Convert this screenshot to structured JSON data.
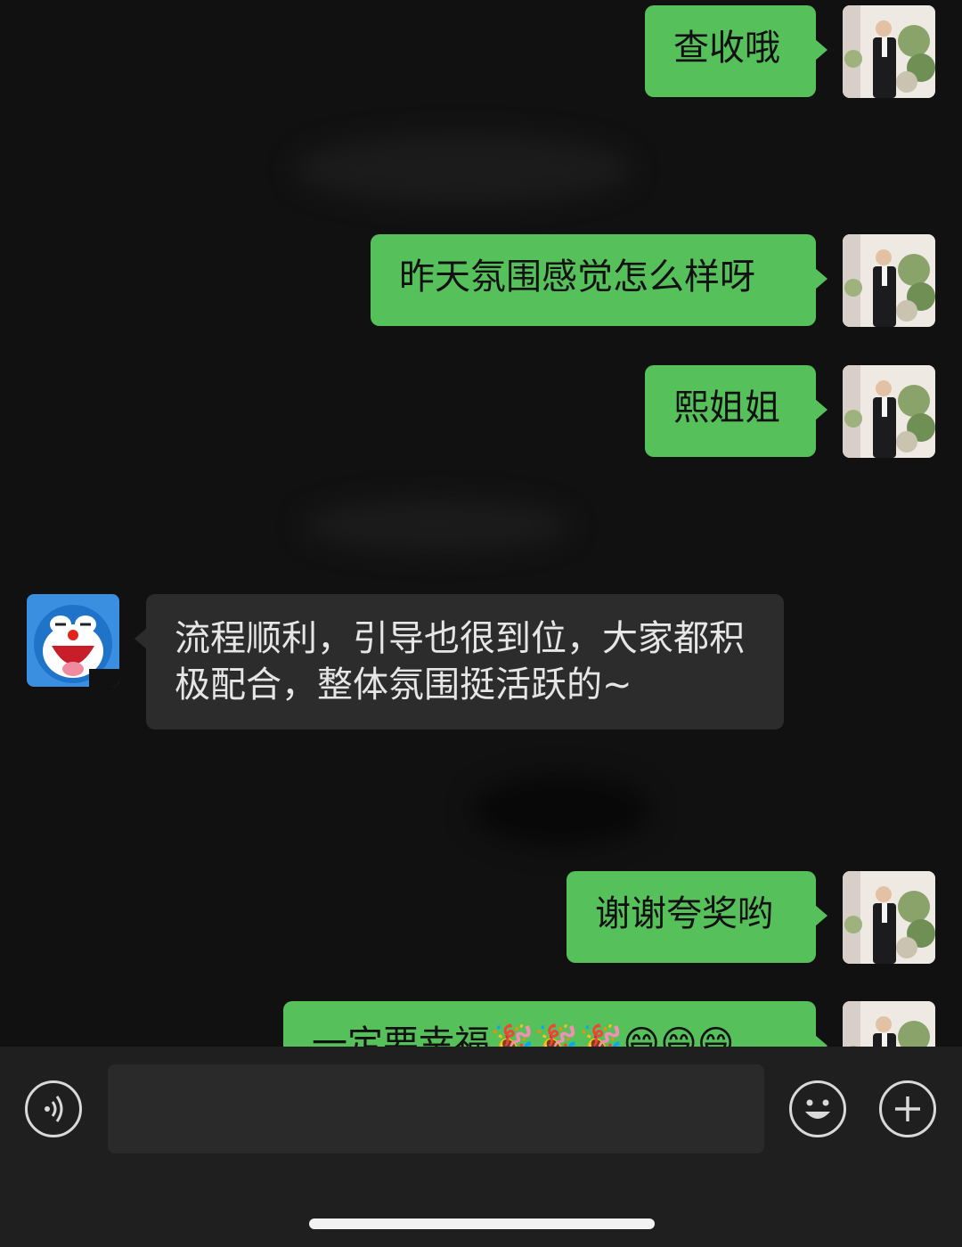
{
  "messages": [
    {
      "direction": "out",
      "text": "查收哦"
    },
    {
      "direction": "out",
      "text": "昨天氛围感觉怎么样呀"
    },
    {
      "direction": "out",
      "text": "熙姐姐"
    },
    {
      "direction": "in",
      "text": "流程顺利，引导也很到位，大家都积极配合，整体氛围挺活跃的~"
    },
    {
      "direction": "out",
      "text": "谢谢夸奖哟"
    },
    {
      "direction": "out",
      "text": "一定要幸福🎉🎉🎉😄😄😄"
    }
  ],
  "input": {
    "value": "",
    "placeholder": ""
  },
  "icons": {
    "voice": "voice-icon",
    "emoji": "emoji-icon",
    "plus": "plus-icon",
    "sender_avatar": "groom-photo-avatar",
    "receiver_avatar": "cartoon-cat-avatar"
  },
  "colors": {
    "background": "#111111",
    "outgoing_bubble": "#56c05b",
    "incoming_bubble": "#2c2c2c",
    "input_bar": "#1f1f1f"
  }
}
